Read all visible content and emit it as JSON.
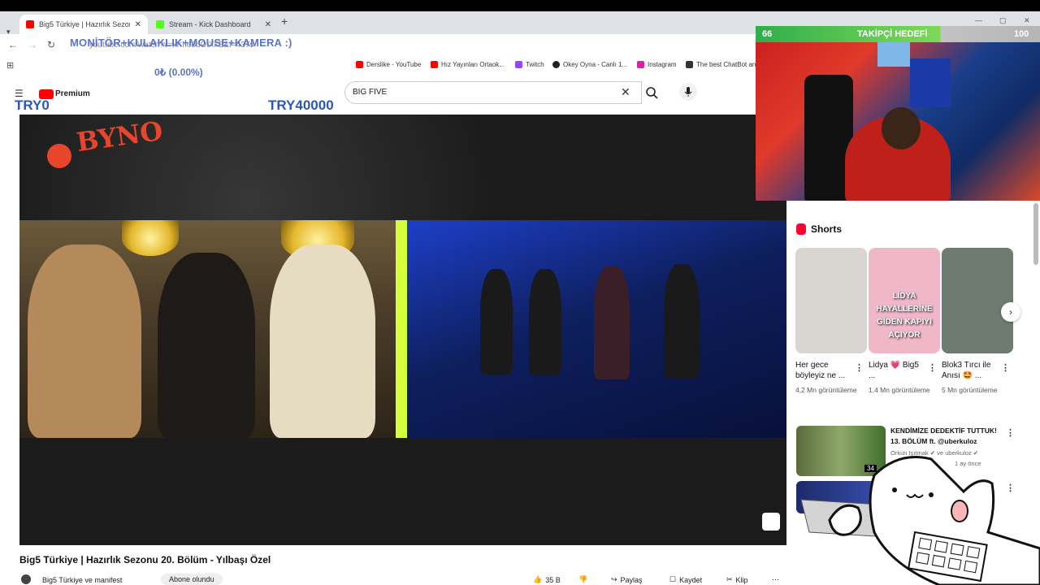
{
  "browser": {
    "tabs": [
      {
        "label": "Big5 Türkiye | Hazırlık Sezon",
        "favicon_color": "#ff0000"
      },
      {
        "label": "Stream - Kick Dashboard",
        "favicon_color": "#53fc18"
      }
    ],
    "url": "youtube.com/watch?v=xKhe8dOtXkE&t=437s",
    "bookmarks": [
      {
        "label": "Derslike - YouTube",
        "color": "#ff0000"
      },
      {
        "label": "Hız Yayınları Ortaok...",
        "color": "#ff0000"
      },
      {
        "label": "Twitch",
        "color": "#9146ff"
      },
      {
        "label": "Okey Oyna - Canlı 1...",
        "color": "#222222"
      },
      {
        "label": "Instagram",
        "color": "#d6249f"
      },
      {
        "label": "The best ChatBot an...",
        "color": "#333333"
      }
    ]
  },
  "overlay": {
    "title_text": "MONİTÖR+KULAKLIK+MOUSE+KAMERA :)",
    "donation_text": "0₺ (0.00%)",
    "goal_current": "TRY0",
    "goal_target": "TRY40000",
    "follower_goal": {
      "label": "TAKİPÇİ HEDEFİ",
      "current": "66",
      "target": "100",
      "progress": 0.66
    },
    "accent_color": "#5a74c9"
  },
  "youtube": {
    "premium_label": "Premium",
    "search_value": "BIG FIVE",
    "video": {
      "title": "Big5 Türkiye | Hazırlık Sezonu 20. Bölüm - Yılbaşı Özel",
      "logo_text": "BYNO",
      "channel": "Big5 Türkiye ve manifest",
      "subscribe_label": "Abone olundu",
      "likes": "35 B",
      "share_label": "Paylaş",
      "save_label": "Kaydet",
      "clip_label": "Klip"
    },
    "shorts": {
      "heading": "Shorts",
      "items": [
        {
          "title": "Her gece böyleyiz ne ...",
          "views": "4,2 Mn görüntüleme",
          "color": "#d9d6d2"
        },
        {
          "title": "Lidya 💗 Big5 ...",
          "views": "1,4 Mn görüntüleme",
          "color": "#f0b7c9",
          "overlay": "LİDYA HAYALLERİNE GİDEN KAPIYI AÇIYOR"
        },
        {
          "title": "Blok3 Tırcı ile Anısı 🤩 ...",
          "views": "5 Mn görüntüleme",
          "color": "#6f7a70"
        }
      ]
    },
    "recommendations": [
      {
        "title": "KENDİMİZE DEDEKTİF TUTTUK! 13. BÖLÜM ft. @uberkuloz",
        "meta": "Orkun Işıtmak ✔ ve uberkuloz ✔",
        "age": "1 ay önce",
        "badge": "34"
      },
      {
        "title": "",
        "meta": "",
        "age": "",
        "badge": ""
      }
    ]
  }
}
